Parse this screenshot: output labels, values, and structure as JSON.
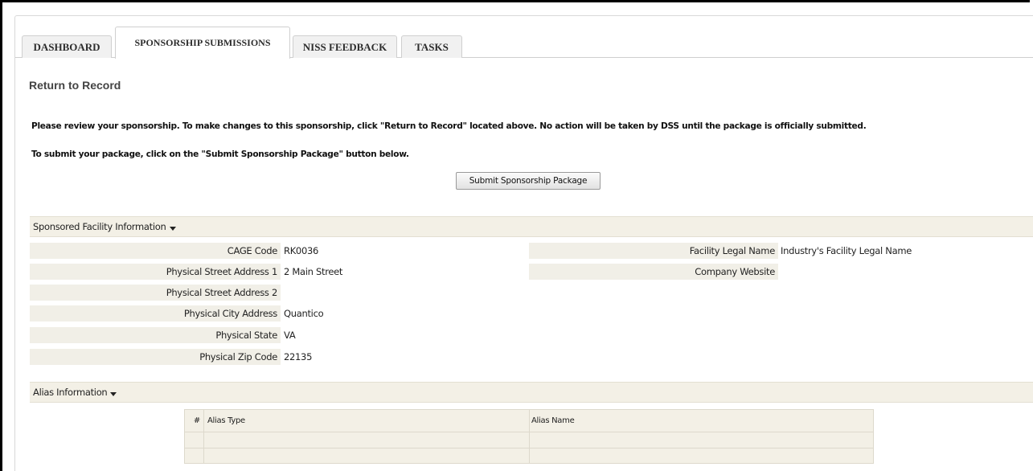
{
  "tabs": [
    {
      "label": "DASHBOARD",
      "active": false
    },
    {
      "label": "SPONSORSHIP SUBMISSIONS",
      "active": true
    },
    {
      "label": "NISS FEEDBACK",
      "active": false
    },
    {
      "label": "TASKS",
      "active": false
    }
  ],
  "return_link": "Return to Record",
  "messages": {
    "review": "Please review your sponsorship. To make changes to this sponsorship, click \"Return to Record\" located above. No action will be taken by DSS until the package is officially submitted.",
    "submit_instruction": "To submit your package, click on the \"Submit Sponsorship Package\" button below."
  },
  "submit_button": "Submit Sponsorship Package",
  "facility_section": {
    "title": "Sponsored Facility Information",
    "left_fields": [
      {
        "label": "CAGE Code",
        "value": "RK0036"
      },
      {
        "label": "Physical Street Address 1",
        "value": "2 Main Street"
      },
      {
        "label": "Physical Street Address 2",
        "value": ""
      },
      {
        "label": "Physical City Address",
        "value": "Quantico"
      },
      {
        "label": "Physical State",
        "value": "VA"
      },
      {
        "label": "Physical Zip Code",
        "value": "22135"
      }
    ],
    "right_fields": [
      {
        "label": "Facility Legal Name",
        "value": "Industry's Facility Legal Name"
      },
      {
        "label": "Company Website",
        "value": ""
      }
    ]
  },
  "alias_section": {
    "title": "Alias Information",
    "columns": [
      "#",
      "Alias Type",
      "Alias Name"
    ],
    "rows": []
  }
}
